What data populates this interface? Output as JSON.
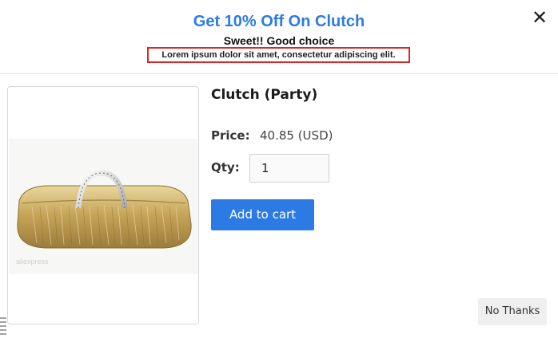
{
  "popup": {
    "promo_title": "Get 10% Off On Clutch",
    "promo_subtitle": "Sweet!! Good choice",
    "promo_description": "Lorem ipsum dolor sit amet, consectetur adipiscing elit.",
    "close_glyph": "✕"
  },
  "product": {
    "name": "Clutch (Party)",
    "price_label": "Price:",
    "price_value": "40.85 (USD)",
    "qty_label": "Qty:",
    "qty_value": "1",
    "add_to_cart_label": "Add to cart",
    "image_watermark": "aliexpress"
  },
  "actions": {
    "no_thanks_label": "No Thanks"
  },
  "colors": {
    "accent": "#2c7be5",
    "promo_title": "#2d7be0",
    "highlight_border": "#d42a2a"
  },
  "icons": {
    "close": "close-icon"
  }
}
